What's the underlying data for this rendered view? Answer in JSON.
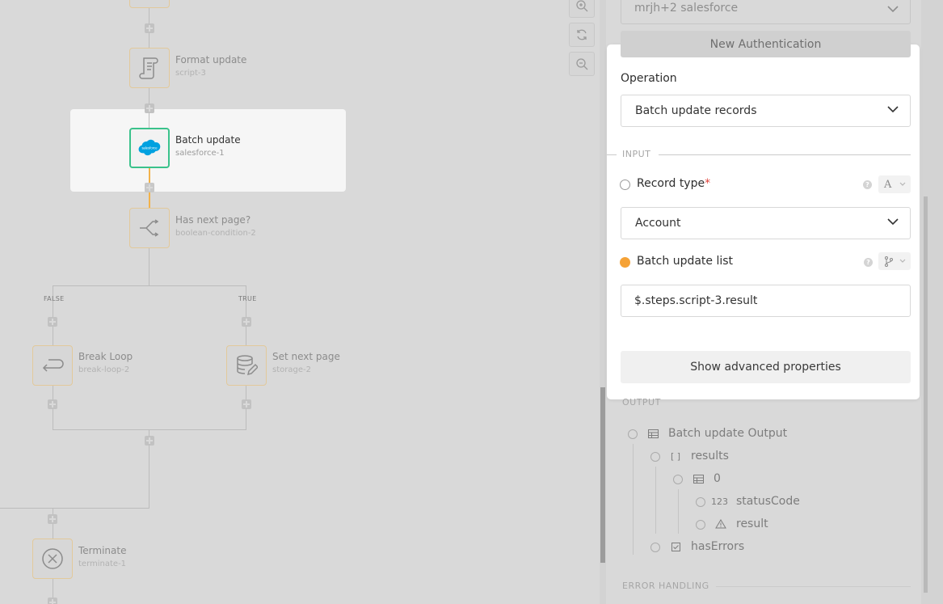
{
  "canvas": {
    "nodes": {
      "format_update": {
        "label": "Format update",
        "id": "script-3",
        "icon": "script-scroll-icon"
      },
      "batch_update": {
        "label": "Batch update",
        "id": "salesforce-1",
        "icon": "salesforce-icon",
        "icon_text": "salesforce"
      },
      "has_next_page": {
        "label": "Has next page?",
        "id": "boolean-condition-2",
        "icon": "branch-icon"
      },
      "break_loop": {
        "label": "Break Loop",
        "id": "break-loop-2",
        "icon": "return-arrow-icon"
      },
      "set_next_page": {
        "label": "Set next page",
        "id": "storage-2",
        "icon": "database-edit-icon"
      },
      "terminate": {
        "label": "Terminate",
        "id": "terminate-1",
        "icon": "close-circle-icon"
      }
    },
    "branches": {
      "false_label": "FALSE",
      "true_label": "TRUE"
    },
    "colors": {
      "selected_border": "#3ac28b",
      "active_connector": "#f2b24a",
      "salesforce_blue": "#00a1e0"
    }
  },
  "panel": {
    "authentication": {
      "value": "mrjh+2 salesforce",
      "new_button": "New Authentication"
    },
    "operation": {
      "label": "Operation",
      "value": "Batch update records"
    },
    "input_section": {
      "title": "INPUT",
      "record_type": {
        "label": "Record type",
        "required_mark": "*",
        "value": "Account",
        "mode_glyph": "A"
      },
      "batch_update_list": {
        "label": "Batch update list",
        "value": "$.steps.script-3.result"
      }
    },
    "advanced_button": "Show advanced properties",
    "output_section": {
      "title": "OUTPUT",
      "tree": {
        "root": "Batch update Output",
        "results": "results",
        "results_icon": "[ ]",
        "item0": "0",
        "status_code": "statusCode",
        "status_code_icon": "123",
        "result": "result",
        "has_errors": "hasErrors"
      }
    },
    "error_section": {
      "title": "ERROR HANDLING"
    },
    "colors": {
      "accent": "#f5a236",
      "required": "#e0433b"
    }
  }
}
